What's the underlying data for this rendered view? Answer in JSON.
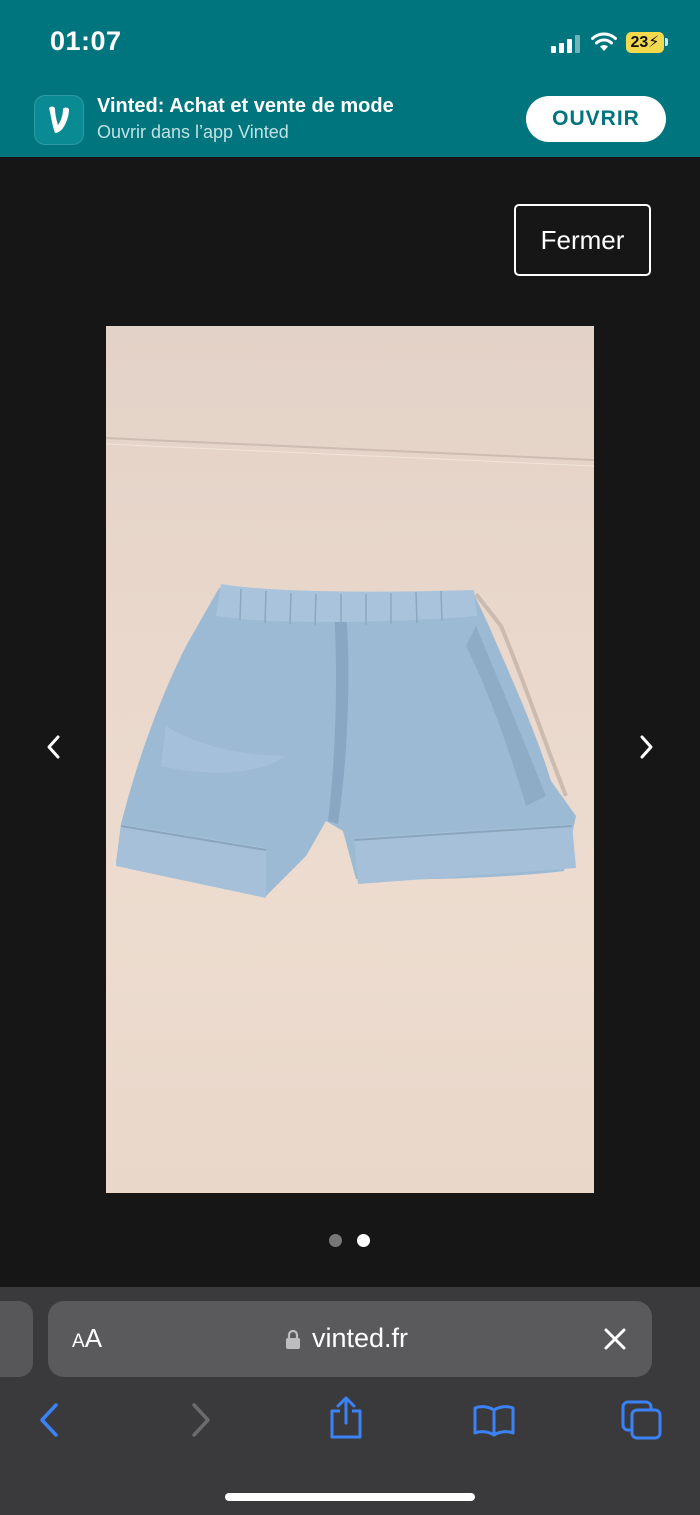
{
  "status_bar": {
    "time": "01:07",
    "battery": "23"
  },
  "banner": {
    "app_name": "Vinted: Achat et vente de mode",
    "subtitle": "Ouvrir dans l’app Vinted",
    "open_label": "OUVRIR",
    "icon_letter": "V"
  },
  "viewer": {
    "close_label": "Fermer",
    "image_count": 2,
    "current_index": 2
  },
  "browser": {
    "text_size_label_small": "A",
    "text_size_label_large": "A",
    "url": "vinted.fr"
  },
  "colors": {
    "brand_teal": "#00757d",
    "viewer_bg": "#161616",
    "toolbar_bg": "#3a3a3c",
    "safari_blue": "#3b82f6"
  },
  "icons": [
    "signal-icon",
    "wifi-icon",
    "battery-icon",
    "vinted-app-icon",
    "chevron-left-icon",
    "chevron-right-icon",
    "lock-icon",
    "clear-icon",
    "back-icon",
    "forward-icon",
    "share-icon",
    "bookmarks-icon",
    "tabs-icon"
  ]
}
